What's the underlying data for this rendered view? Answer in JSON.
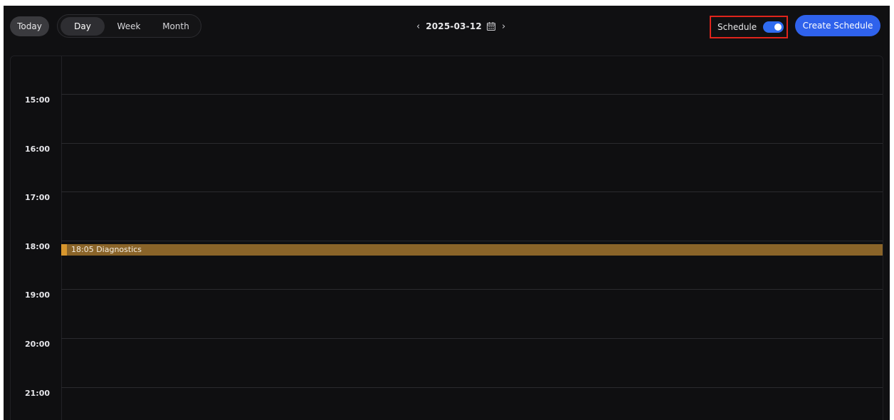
{
  "toolbar": {
    "today_label": "Today",
    "views": [
      "Day",
      "Week",
      "Month"
    ],
    "active_view": "Day",
    "date": "2025-03-12",
    "prev_icon": "chevron-left-icon",
    "next_icon": "chevron-right-icon",
    "calendar_icon": "calendar-icon",
    "schedule_toggle_label": "Schedule",
    "schedule_toggle_on": true,
    "create_label": "Create Schedule"
  },
  "colors": {
    "background": "#101012",
    "accent": "#2f62ec",
    "event": "#8a6429",
    "event_marker": "#d8962d",
    "highlight_box": "#e0241c"
  },
  "hours": [
    "15:00",
    "16:00",
    "17:00",
    "18:00",
    "19:00",
    "20:00",
    "21:00"
  ],
  "events": [
    {
      "time": "18:05",
      "title": "Diagnostics",
      "label": "18:05 Diagnostics"
    }
  ]
}
